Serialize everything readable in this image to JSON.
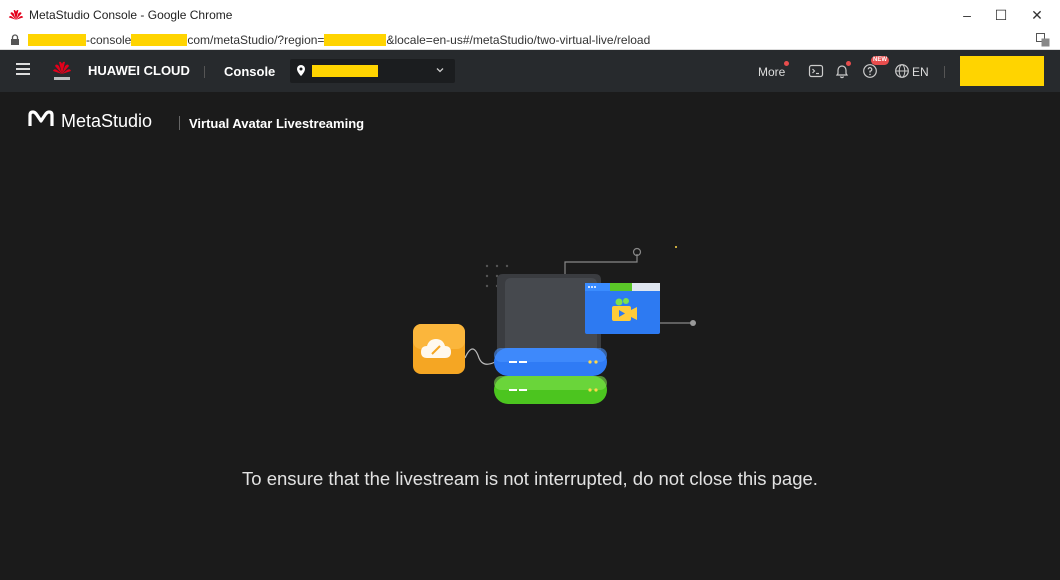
{
  "window": {
    "title": "MetaStudio Console - Google Chrome",
    "controls": {
      "minimize": "–",
      "maximize": "☐",
      "close": "✕"
    }
  },
  "address": {
    "part1": "-console",
    "part2": "com/metaStudio/?region=",
    "part3": "&locale=en-us#/metaStudio/two-virtual-live/reload"
  },
  "header": {
    "brand": "HUAWEI CLOUD",
    "console": "Console",
    "more": "More",
    "language": "EN",
    "new_badge": "NEW"
  },
  "page": {
    "product_name": "MetaStudio",
    "section_title": "Virtual Avatar Livestreaming",
    "message": "To ensure that the livestream is not interrupted, do not close this page."
  },
  "colors": {
    "header_bg": "#272a2d",
    "page_bg": "#1b1b1b",
    "redaction": "#ffd400",
    "badge_red": "#e84d4d"
  }
}
